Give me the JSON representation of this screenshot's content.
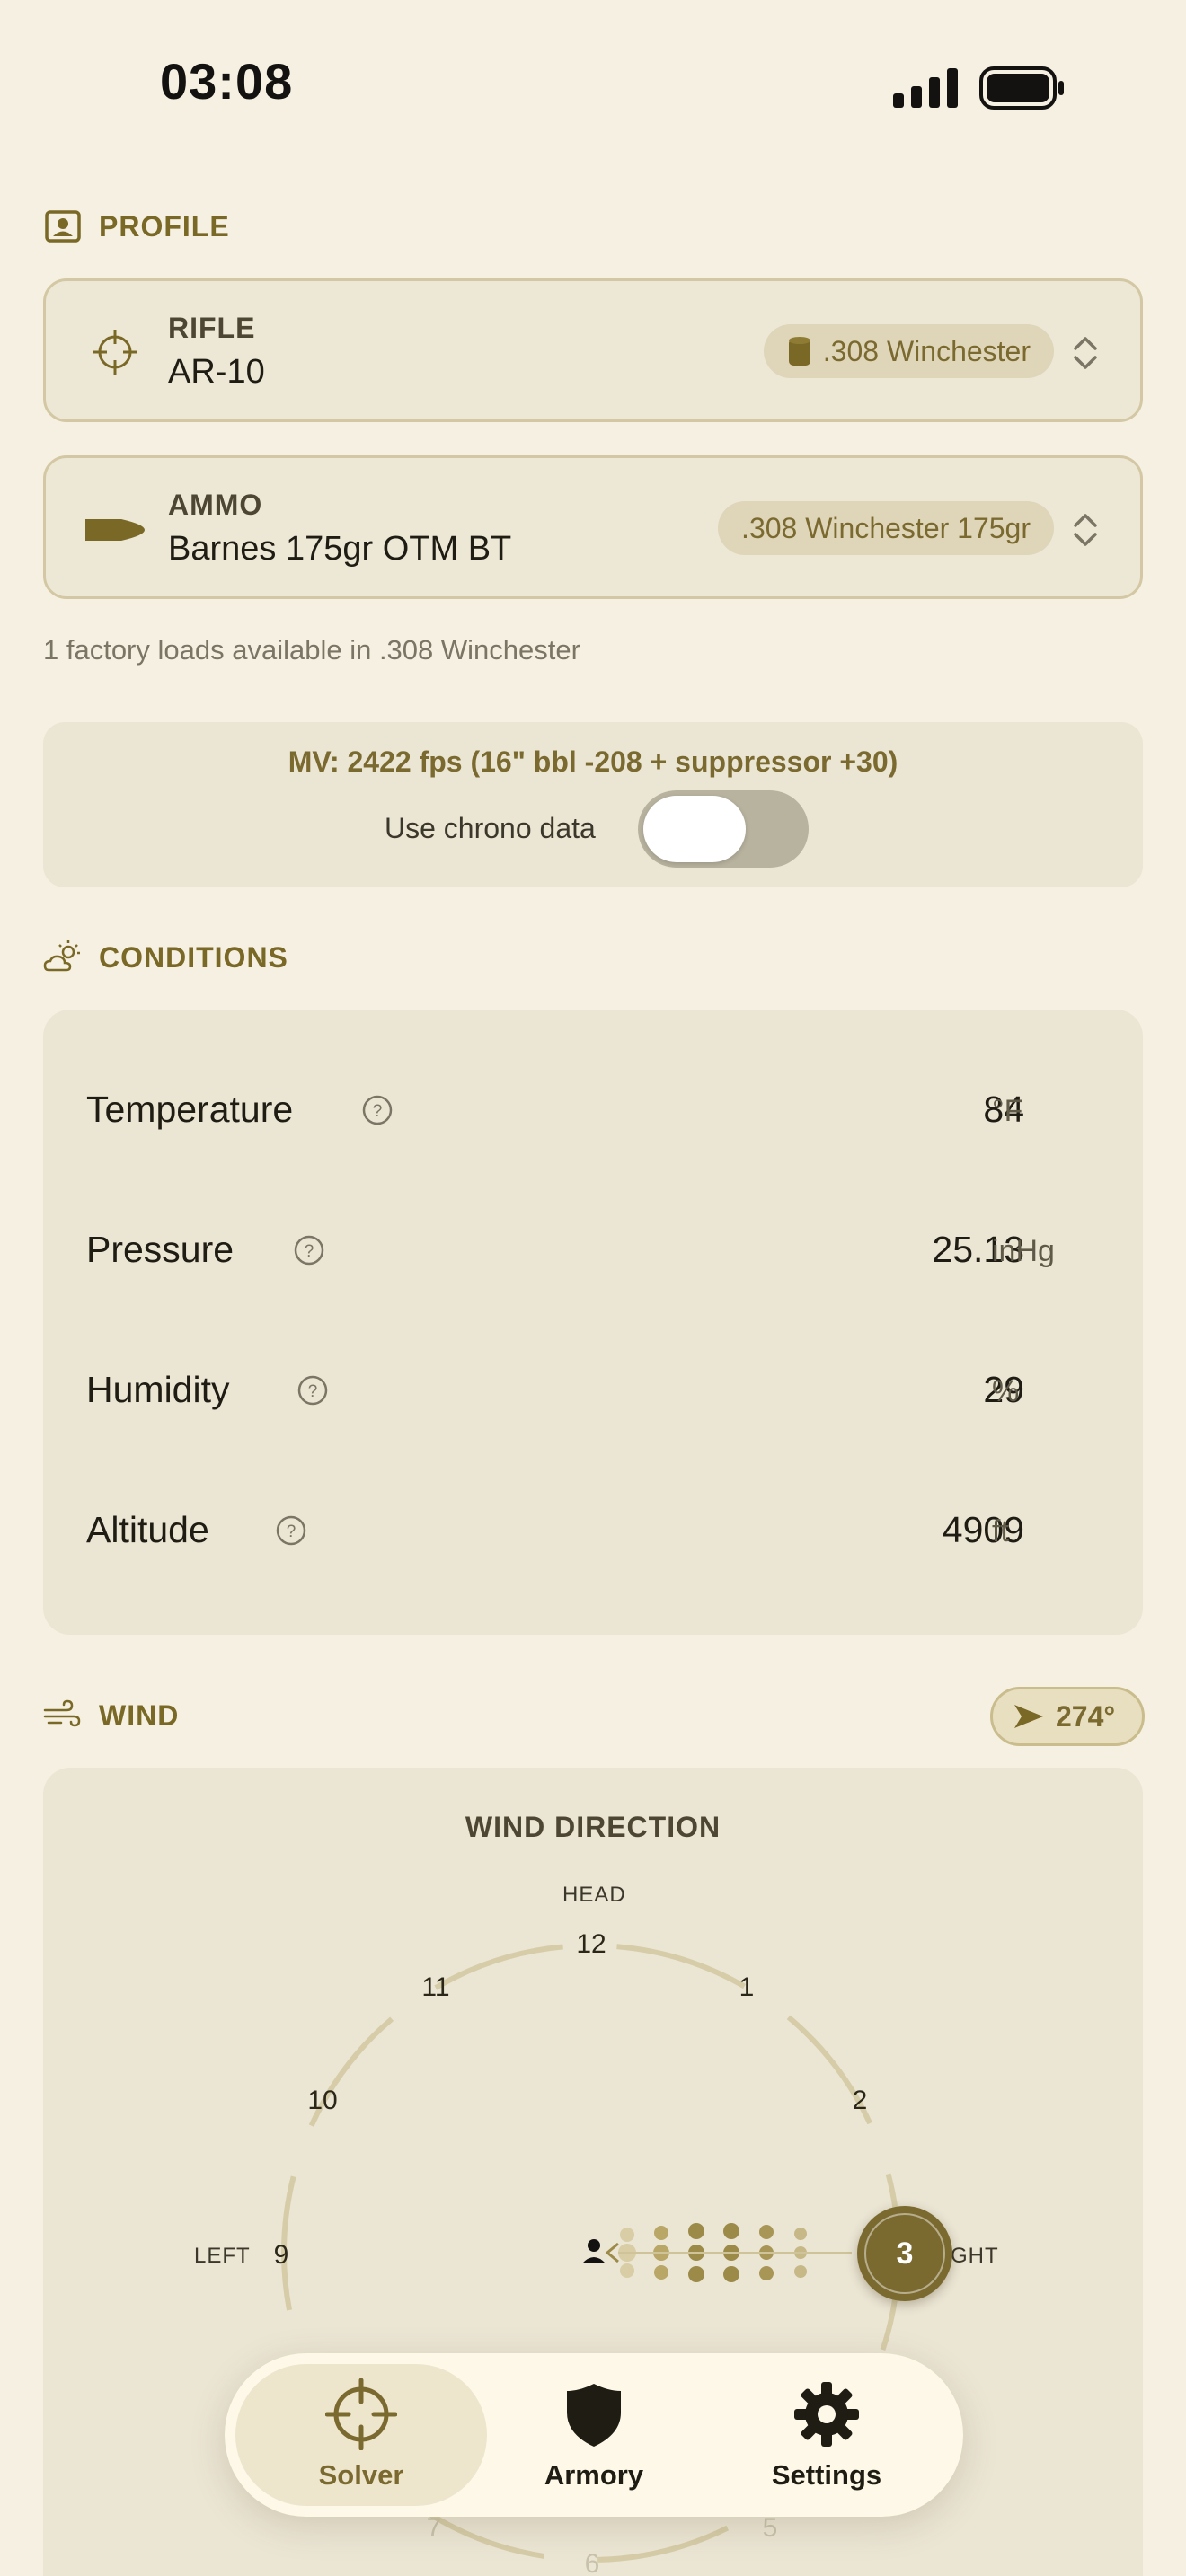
{
  "status_bar": {
    "time": "03:08"
  },
  "profile": {
    "section_title": "PROFILE",
    "rifle": {
      "label": "RIFLE",
      "value": "AR-10",
      "pill": ".308 Winchester"
    },
    "ammo": {
      "label": "AMMO",
      "value": "Barnes 175gr OTM BT",
      "pill": ".308 Winchester 175gr"
    },
    "factory_note": "1 factory loads available in .308 Winchester",
    "mv_text": "MV: 2422 fps (16\" bbl -208 + suppressor +30)",
    "chrono_label": "Use chrono data",
    "chrono_enabled": false
  },
  "conditions": {
    "section_title": "CONDITIONS",
    "rows": [
      {
        "label": "Temperature",
        "value": "84",
        "unit": "°F"
      },
      {
        "label": "Pressure",
        "value": "25.13",
        "unit": "inHg"
      },
      {
        "label": "Humidity",
        "value": "29",
        "unit": "%"
      },
      {
        "label": "Altitude",
        "value": "4909",
        "unit": "ft"
      }
    ]
  },
  "wind": {
    "section_title": "WIND",
    "bearing": "274°",
    "dial_title": "WIND DIRECTION",
    "head_label": "HEAD",
    "left_label": "LEFT",
    "right_label": "GHT",
    "clock": [
      "12",
      "1",
      "2",
      "3",
      "5",
      "6",
      "7",
      "9",
      "10",
      "11"
    ],
    "selected_clock": "3"
  },
  "tabs": [
    {
      "label": "Solver",
      "icon": "crosshair-icon",
      "active": true
    },
    {
      "label": "Armory",
      "icon": "shield-icon",
      "active": false
    },
    {
      "label": "Settings",
      "icon": "gear-icon",
      "active": false
    }
  ],
  "colors": {
    "accent": "#7b6a30",
    "background": "#f5f0e1",
    "card": "#ebe5d4"
  }
}
